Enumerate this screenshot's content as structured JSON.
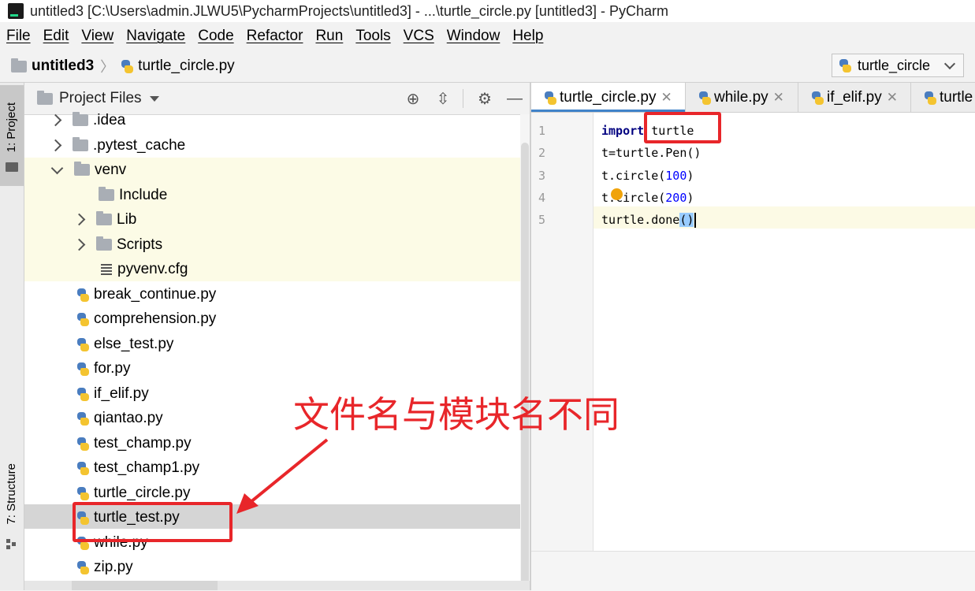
{
  "window": {
    "title": "untitled3 [C:\\Users\\admin.JLWU5\\PycharmProjects\\untitled3] - ...\\turtle_circle.py [untitled3] - PyCharm"
  },
  "menu": [
    "File",
    "Edit",
    "View",
    "Navigate",
    "Code",
    "Refactor",
    "Run",
    "Tools",
    "VCS",
    "Window",
    "Help"
  ],
  "breadcrumb": {
    "project": "untitled3",
    "file": "turtle_circle.py"
  },
  "run_config": {
    "selected": "turtle_circle"
  },
  "tool_strip": {
    "project_label": "1: Project",
    "structure_label": "7: Structure"
  },
  "project_panel": {
    "title": "Project Files",
    "tree": [
      {
        "name": ".idea",
        "kind": "folder",
        "expand": "collapsed"
      },
      {
        "name": ".pytest_cache",
        "kind": "folder",
        "expand": "collapsed"
      },
      {
        "name": "venv",
        "kind": "folder",
        "expand": "expanded"
      },
      {
        "name": "Include",
        "kind": "folder",
        "expand": "none"
      },
      {
        "name": "Lib",
        "kind": "folder",
        "expand": "collapsed"
      },
      {
        "name": "Scripts",
        "kind": "folder",
        "expand": "collapsed"
      },
      {
        "name": "pyvenv.cfg",
        "kind": "config",
        "expand": "none"
      },
      {
        "name": "break_continue.py",
        "kind": "python",
        "expand": "none"
      },
      {
        "name": "comprehension.py",
        "kind": "python",
        "expand": "none"
      },
      {
        "name": "else_test.py",
        "kind": "python",
        "expand": "none"
      },
      {
        "name": "for.py",
        "kind": "python",
        "expand": "none"
      },
      {
        "name": "if_elif.py",
        "kind": "python",
        "expand": "none"
      },
      {
        "name": "qiantao.py",
        "kind": "python",
        "expand": "none"
      },
      {
        "name": "test_champ.py",
        "kind": "python",
        "expand": "none"
      },
      {
        "name": "test_champ1.py",
        "kind": "python",
        "expand": "none"
      },
      {
        "name": "turtle_circle.py",
        "kind": "python",
        "expand": "none"
      },
      {
        "name": "turtle_test.py",
        "kind": "python",
        "expand": "none",
        "selected": true
      },
      {
        "name": "while.py",
        "kind": "python",
        "expand": "none"
      },
      {
        "name": "zip.py",
        "kind": "python",
        "expand": "none"
      }
    ]
  },
  "editor_tabs": [
    {
      "label": "turtle_circle.py",
      "active": true
    },
    {
      "label": "while.py",
      "active": false
    },
    {
      "label": "if_elif.py",
      "active": false
    },
    {
      "label": "turtle",
      "active": false
    }
  ],
  "code": {
    "line_numbers": [
      "1",
      "2",
      "3",
      "4",
      "5"
    ],
    "line1": {
      "keyword": "import",
      "rest": " turtle"
    },
    "line2": "t=turtle.Pen()",
    "line3": {
      "prefix": "t.circle(",
      "num": "100",
      "suffix": ")"
    },
    "line4": {
      "prefix": "t.",
      "mid": "circle(",
      "num": "200",
      "suffix": ")"
    },
    "line5": {
      "prefix": "turtle.done",
      "bracket": "()"
    }
  },
  "annotation": {
    "text": "文件名与模块名不同",
    "color": "#e8262a"
  },
  "colors": {
    "accent": "#4083c9",
    "selection": "#d5d5d5",
    "venv_highlight": "#fcfbe6"
  }
}
